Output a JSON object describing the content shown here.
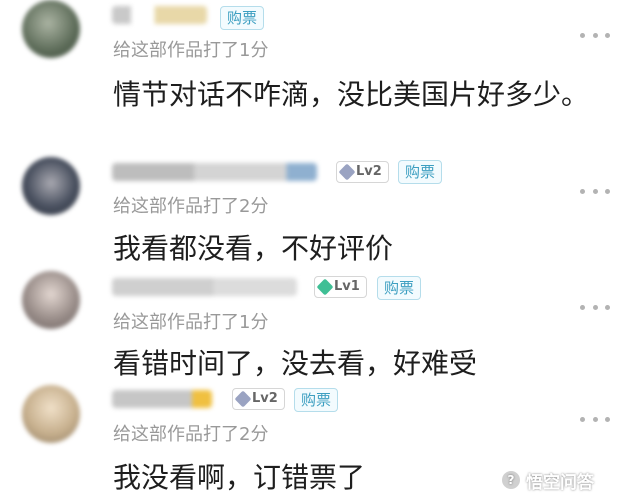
{
  "comments": [
    {
      "level": "",
      "buy_label": "购票",
      "rating": "给这部作品打了1分",
      "text": "情节对话不咋滴，没比美国片好多少。"
    },
    {
      "level": "Lv2",
      "buy_label": "购票",
      "rating": "给这部作品打了2分",
      "text": "我看都没看，不好评价"
    },
    {
      "level": "Lv1",
      "buy_label": "购票",
      "rating": "给这部作品打了1分",
      "text": "看错时间了，没去看，好难受"
    },
    {
      "level": "Lv2",
      "buy_label": "购票",
      "rating": "给这部作品打了2分",
      "text": "我没看啊，订错票了"
    }
  ],
  "watermark": {
    "text": "悟空问答"
  },
  "colors": {
    "buy_badge": "#3d9fc1",
    "lv2_gem": "#9aa3c2",
    "lv1_gem": "#3fbf95"
  }
}
